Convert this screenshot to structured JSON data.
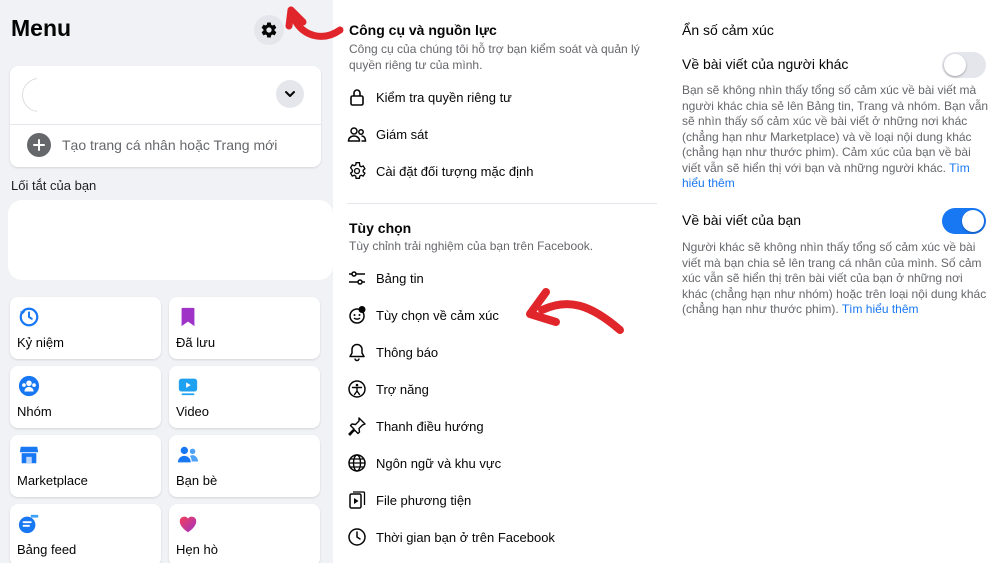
{
  "menu": {
    "title": "Menu",
    "create_label": "Tạo trang cá nhân hoặc Trang mới",
    "shortcuts_label": "Lối tắt của bạn",
    "tiles": [
      {
        "label": "Kỷ niệm",
        "icon": "memories-icon"
      },
      {
        "label": "Đã lưu",
        "icon": "saved-icon"
      },
      {
        "label": "Nhóm",
        "icon": "groups-icon"
      },
      {
        "label": "Video",
        "icon": "video-icon"
      },
      {
        "label": "Marketplace",
        "icon": "marketplace-icon"
      },
      {
        "label": "Bạn bè",
        "icon": "friends-icon"
      },
      {
        "label": "Bảng feed",
        "icon": "feeds-icon"
      },
      {
        "label": "Hẹn hò",
        "icon": "dating-icon"
      }
    ]
  },
  "settings": {
    "tools": {
      "title": "Công cụ và nguồn lực",
      "desc": "Công cụ của chúng tôi hỗ trợ bạn kiểm soát và quản lý quyền riêng tư của mình.",
      "items": [
        {
          "label": "Kiểm tra quyền riêng tư",
          "icon": "lock-icon"
        },
        {
          "label": "Giám sát",
          "icon": "supervision-icon"
        },
        {
          "label": "Cài đặt đối tượng mặc định",
          "icon": "gear-icon"
        }
      ]
    },
    "prefs": {
      "title": "Tùy chọn",
      "desc": "Tùy chỉnh trải nghiệm của bạn trên Facebook.",
      "items": [
        {
          "label": "Bảng tin",
          "icon": "sliders-icon"
        },
        {
          "label": "Tùy chọn về cảm xúc",
          "icon": "reactions-icon"
        },
        {
          "label": "Thông báo",
          "icon": "bell-icon"
        },
        {
          "label": "Trợ năng",
          "icon": "accessibility-icon"
        },
        {
          "label": "Thanh điều hướng",
          "icon": "pin-icon"
        },
        {
          "label": "Ngôn ngữ và khu vực",
          "icon": "globe-icon"
        },
        {
          "label": "File phương tiện",
          "icon": "media-icon"
        },
        {
          "label": "Thời gian bạn ở trên Facebook",
          "icon": "clock-icon"
        }
      ]
    }
  },
  "reactions": {
    "title": "Ẩn số cảm xúc",
    "others": {
      "label": "Về bài viết của người khác",
      "desc": "Bạn sẽ không nhìn thấy tổng số cảm xúc về bài viết mà người khác chia sẻ lên Bảng tin, Trang và nhóm. Bạn vẫn sẽ nhìn thấy số cảm xúc về bài viết ở những nơi khác (chẳng hạn như Marketplace) và về loại nội dung khác (chẳng hạn như thước phim). Cảm xúc của bạn về bài viết vẫn sẽ hiển thị với bạn và những người khác.",
      "learn_more": "Tìm hiểu thêm",
      "enabled": false
    },
    "yours": {
      "label": "Về bài viết của bạn",
      "desc": "Người khác sẽ không nhìn thấy tổng số cảm xúc về bài viết mà bạn chia sẻ lên trang cá nhân của mình. Số cảm xúc vẫn sẽ hiển thị trên bài viết của bạn ở những nơi khác (chẳng hạn như nhóm) hoặc trên loại nội dung khác (chẳng hạn như thước phim).",
      "learn_more": "Tìm hiểu thêm",
      "enabled": true
    }
  },
  "colors": {
    "accent": "#1877f2",
    "annotation_arrow": "#e0262b",
    "menu_bg": "#f0f2f5"
  }
}
